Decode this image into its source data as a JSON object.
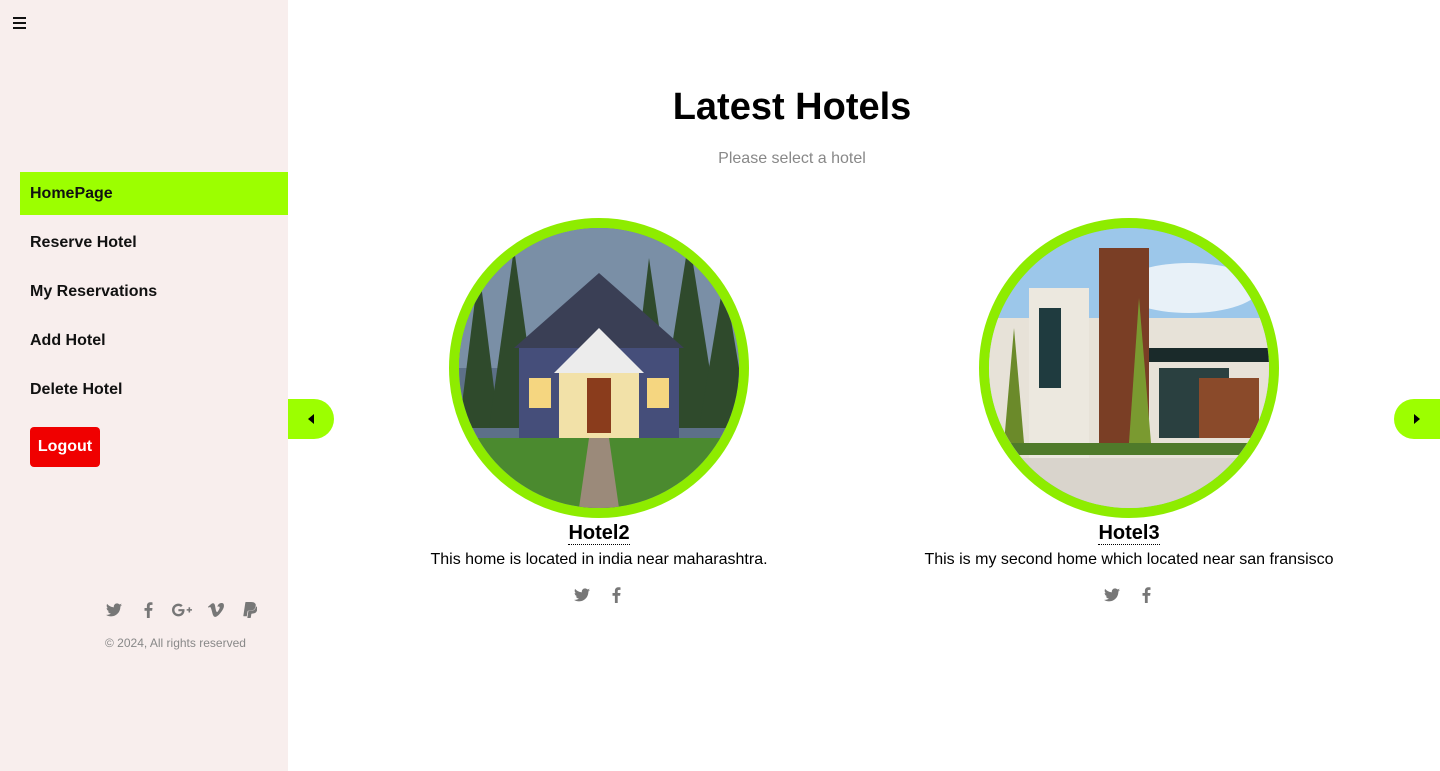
{
  "sidebar": {
    "nav_items": [
      {
        "label": "HomePage",
        "active": true
      },
      {
        "label": "Reserve Hotel"
      },
      {
        "label": "My Reservations"
      },
      {
        "label": "Add Hotel"
      },
      {
        "label": "Delete Hotel"
      }
    ],
    "logout_label": "Logout",
    "social_icons": [
      "twitter-icon",
      "facebook-icon",
      "google-plus-icon",
      "vimeo-icon",
      "paypal-icon"
    ],
    "copyright": "© 2024, All rights reserved"
  },
  "main": {
    "title": "Latest Hotels",
    "subtitle": "Please select a hotel",
    "hotels": [
      {
        "name": "Hotel2",
        "description": "This home is located in india near maharashtra.",
        "social_icons": [
          "twitter-icon",
          "facebook-icon"
        ]
      },
      {
        "name": "Hotel3",
        "description": "This is my second home which located near san fransisco",
        "social_icons": [
          "twitter-icon",
          "facebook-icon"
        ]
      }
    ]
  },
  "colors": {
    "sidebar_bg": "#f8eeed",
    "accent": "#9cff00",
    "ring": "#8eec00",
    "logout": "#f00000"
  }
}
